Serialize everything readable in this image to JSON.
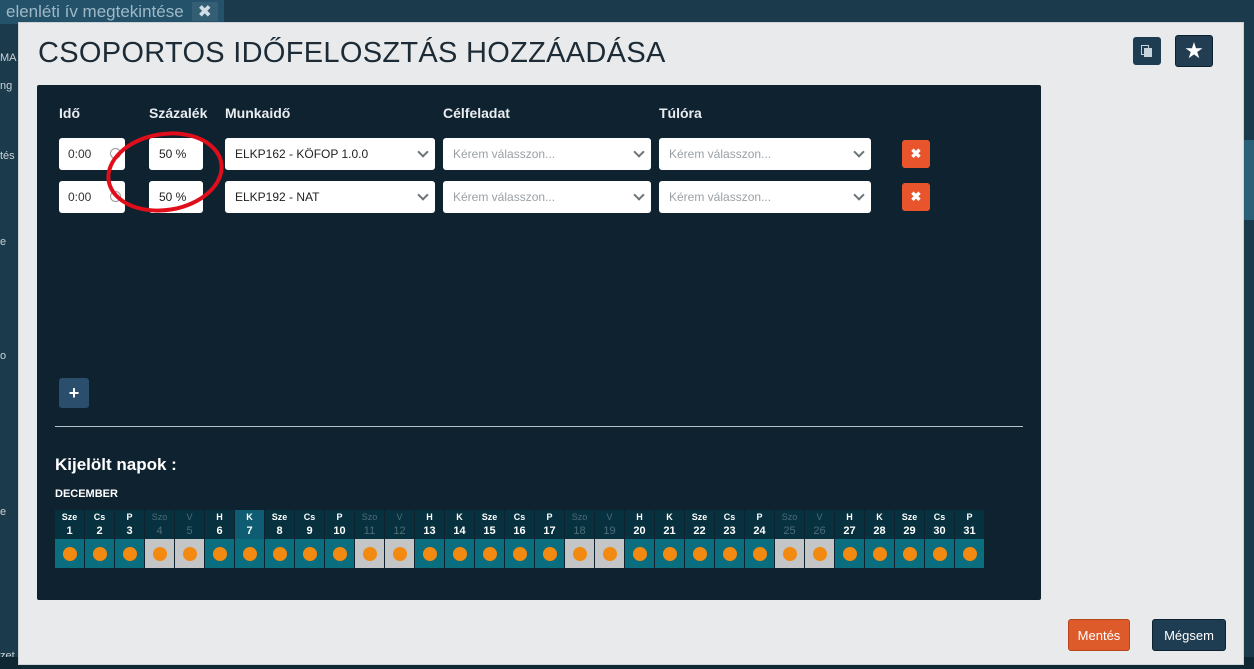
{
  "background": {
    "tab_title": "elenléti ív megtekintése",
    "tab_close": "✖",
    "edge_fragments": [
      "MA",
      "ng",
      "tés",
      "e",
      "o",
      "e",
      "zet"
    ]
  },
  "modal": {
    "title": "CSOPORTOS IDŐFELOSZTÁS HOZZÁADÁSA",
    "header_buttons": [
      {
        "icon": "copy-icon",
        "glyph": "▌"
      },
      {
        "icon": "star-icon",
        "glyph": "★"
      }
    ],
    "columns": {
      "ido": "Idő",
      "szazalek": "Százalék",
      "munkaido": "Munkaidő",
      "celfeladat": "Célfeladat",
      "tulora": "Túlóra"
    },
    "rows": [
      {
        "time": "0:00",
        "percent": "50 %",
        "work": "ELKP162 - KÖFOP 1.0.0",
        "target_placeholder": "Kérem válasszon...",
        "overtime_placeholder": "Kérem válasszon...",
        "delete_glyph": "✖"
      },
      {
        "time": "0:00",
        "percent": "50 %",
        "work": "ELKP192 - NAT",
        "target_placeholder": "Kérem válasszon...",
        "overtime_placeholder": "Kérem válasszon...",
        "delete_glyph": "✖"
      }
    ],
    "add_row_glyph": "+",
    "selected_days_label": "Kijelölt napok :",
    "month": "DECEMBER",
    "days": [
      {
        "n": "Sze",
        "d": "1",
        "w": false
      },
      {
        "n": "Cs",
        "d": "2",
        "w": false
      },
      {
        "n": "P",
        "d": "3",
        "w": false
      },
      {
        "n": "Szo",
        "d": "4",
        "w": true
      },
      {
        "n": "V",
        "d": "5",
        "w": true
      },
      {
        "n": "H",
        "d": "6",
        "w": false
      },
      {
        "n": "K",
        "d": "7",
        "w": false,
        "today": true
      },
      {
        "n": "Sze",
        "d": "8",
        "w": false
      },
      {
        "n": "Cs",
        "d": "9",
        "w": false
      },
      {
        "n": "P",
        "d": "10",
        "w": false
      },
      {
        "n": "Szo",
        "d": "11",
        "w": true
      },
      {
        "n": "V",
        "d": "12",
        "w": true
      },
      {
        "n": "H",
        "d": "13",
        "w": false
      },
      {
        "n": "K",
        "d": "14",
        "w": false
      },
      {
        "n": "Sze",
        "d": "15",
        "w": false
      },
      {
        "n": "Cs",
        "d": "16",
        "w": false
      },
      {
        "n": "P",
        "d": "17",
        "w": false
      },
      {
        "n": "Szo",
        "d": "18",
        "w": true
      },
      {
        "n": "V",
        "d": "19",
        "w": true
      },
      {
        "n": "H",
        "d": "20",
        "w": false
      },
      {
        "n": "K",
        "d": "21",
        "w": false
      },
      {
        "n": "Sze",
        "d": "22",
        "w": false
      },
      {
        "n": "Cs",
        "d": "23",
        "w": false
      },
      {
        "n": "P",
        "d": "24",
        "w": false
      },
      {
        "n": "Szo",
        "d": "25",
        "w": true
      },
      {
        "n": "V",
        "d": "26",
        "w": true
      },
      {
        "n": "H",
        "d": "27",
        "w": false
      },
      {
        "n": "K",
        "d": "28",
        "w": false
      },
      {
        "n": "Sze",
        "d": "29",
        "w": false
      },
      {
        "n": "Cs",
        "d": "30",
        "w": false
      },
      {
        "n": "P",
        "d": "31",
        "w": false
      }
    ],
    "footer": {
      "save": "Mentés",
      "cancel": "Mégsem"
    }
  },
  "colors": {
    "panel": "#0f2230",
    "accent_orange": "#e8542b",
    "dot_orange": "#f28a12",
    "annotation_red": "#e00d1a",
    "day_cell": "#0a6e7e"
  }
}
